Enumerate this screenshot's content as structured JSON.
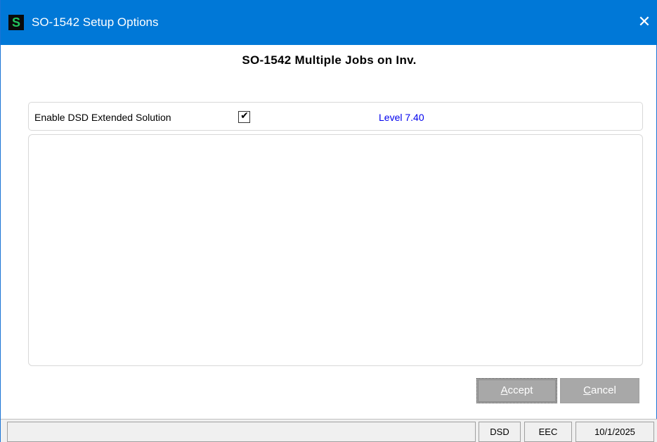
{
  "window": {
    "title": "SO-1542 Setup Options",
    "app_icon_letter": "S",
    "close_glyph": "✕",
    "title_bar_color": "#0078d7"
  },
  "main": {
    "heading": "SO-1542 Multiple Jobs on Inv.",
    "option": {
      "label": "Enable DSD Extended Solution",
      "checked": true,
      "check_glyph": "✔",
      "level_text": "Level  7.40",
      "level_color": "#0000ee"
    }
  },
  "buttons": {
    "accept": {
      "hotkey": "A",
      "rest": "ccept"
    },
    "cancel": {
      "hotkey": "C",
      "rest": "ancel"
    },
    "button_color": "#a8a8a8"
  },
  "statusbar": {
    "main": "",
    "dsd": "DSD",
    "eec": "EEC",
    "date": "10/1/2025"
  }
}
